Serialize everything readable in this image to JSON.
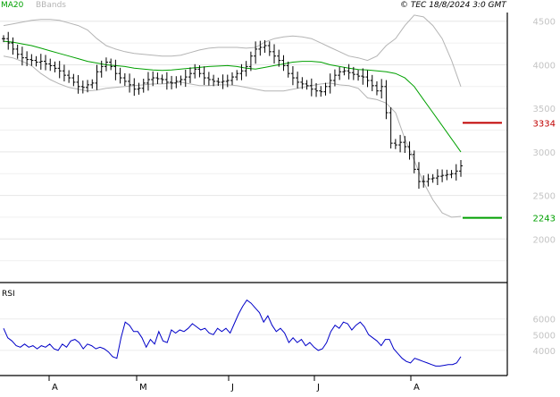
{
  "header": {
    "legend": [
      {
        "label": "MA20",
        "color": "#00a000"
      },
      {
        "label": "BBands",
        "color": "#b4b4b4"
      }
    ],
    "copyright": "© TEC 18/8/2024 3:0 GMT"
  },
  "chart_data": [
    {
      "type": "ohlc",
      "panel": "price",
      "y_ticks": [
        "4500",
        "4000",
        "3500",
        "3000",
        "2500",
        "2000"
      ],
      "ylim": [
        1500,
        4600
      ],
      "x_labels": [
        "A",
        "M",
        "J",
        "J",
        "A"
      ],
      "grid": true,
      "series": [
        {
          "name": "MA20",
          "color": "#00a000",
          "values": [
            4270,
            4260,
            4240,
            4220,
            4190,
            4160,
            4130,
            4100,
            4070,
            4040,
            4020,
            4000,
            3990,
            3980,
            3960,
            3950,
            3940,
            3935,
            3940,
            3950,
            3960,
            3970,
            3980,
            3985,
            3990,
            3980,
            3960,
            3950,
            3970,
            3990,
            4010,
            4030,
            4040,
            4040,
            4030,
            4000,
            3980,
            3960,
            3945,
            3940,
            3930,
            3920,
            3900,
            3850,
            3750,
            3600,
            3450,
            3300,
            3150,
            3000
          ]
        },
        {
          "name": "BBands",
          "color": "#b4b4b4",
          "upper": [
            4450,
            4470,
            4490,
            4510,
            4520,
            4520,
            4510,
            4480,
            4450,
            4400,
            4300,
            4220,
            4180,
            4150,
            4130,
            4120,
            4110,
            4100,
            4100,
            4110,
            4140,
            4170,
            4190,
            4200,
            4200,
            4200,
            4190,
            4200,
            4260,
            4300,
            4320,
            4330,
            4320,
            4300,
            4250,
            4200,
            4150,
            4100,
            4080,
            4050,
            4100,
            4220,
            4300,
            4450,
            4570,
            4550,
            4450,
            4300,
            4050,
            3750
          ],
          "lower": [
            4100,
            4080,
            4040,
            3990,
            3900,
            3830,
            3780,
            3740,
            3720,
            3700,
            3710,
            3730,
            3740,
            3750,
            3760,
            3770,
            3780,
            3780,
            3790,
            3800,
            3780,
            3760,
            3760,
            3770,
            3770,
            3760,
            3740,
            3720,
            3700,
            3700,
            3700,
            3720,
            3740,
            3760,
            3780,
            3790,
            3770,
            3760,
            3730,
            3620,
            3600,
            3560,
            3450,
            3150,
            2900,
            2650,
            2450,
            2300,
            2250,
            2260
          ]
        }
      ],
      "ohlc_approx_close": [
        4300,
        4250,
        4180,
        4120,
        4080,
        4060,
        4050,
        4030,
        4040,
        4010,
        3990,
        3960,
        3930,
        3880,
        3850,
        3800,
        3750,
        3740,
        3770,
        3790,
        3920,
        3980,
        4030,
        3980,
        3900,
        3850,
        3810,
        3770,
        3720,
        3730,
        3790,
        3830,
        3850,
        3840,
        3830,
        3800,
        3790,
        3810,
        3830,
        3860,
        3900,
        3950,
        3900,
        3850,
        3830,
        3810,
        3800,
        3810,
        3820,
        3860,
        3900,
        3930,
        3980,
        4100,
        4180,
        4200,
        4220,
        4150,
        4100,
        4050,
        3990,
        3900,
        3850,
        3800,
        3780,
        3760,
        3720,
        3700,
        3690,
        3750,
        3820,
        3880,
        3920,
        3930,
        3910,
        3890,
        3870,
        3860,
        3820,
        3760,
        3700,
        3750,
        3450,
        3100,
        3080,
        3110,
        3060,
        2970,
        2800,
        2660,
        2660,
        2690,
        2700,
        2720,
        2730,
        2740,
        2750,
        2780,
        2840
      ],
      "levels": [
        {
          "label": "3334",
          "value": 3334,
          "color": "#c00000"
        },
        {
          "label": "2243",
          "value": 2243,
          "color": "#00a000"
        }
      ]
    },
    {
      "type": "line",
      "panel": "rsi",
      "title": "RSI",
      "y_ticks": [
        "6000",
        "5000",
        "4000"
      ],
      "ylim": [
        2400,
        8200
      ],
      "series": [
        {
          "name": "RSI",
          "color": "#0000c8",
          "values": [
            5400,
            4800,
            4600,
            4300,
            4200,
            4400,
            4200,
            4300,
            4100,
            4300,
            4200,
            4400,
            4100,
            4000,
            4400,
            4200,
            4600,
            4700,
            4500,
            4100,
            4400,
            4300,
            4100,
            4200,
            4100,
            3900,
            3600,
            3500,
            4800,
            5800,
            5600,
            5200,
            5200,
            4800,
            4200,
            4700,
            4400,
            5200,
            4600,
            4500,
            5300,
            5100,
            5300,
            5200,
            5400,
            5700,
            5500,
            5300,
            5400,
            5100,
            5000,
            5400,
            5200,
            5400,
            5100,
            5700,
            6300,
            6800,
            7200,
            7000,
            6700,
            6400,
            5800,
            6200,
            5600,
            5200,
            5400,
            5100,
            4500,
            4800,
            4500,
            4700,
            4300,
            4500,
            4200,
            4000,
            4100,
            4500,
            5200,
            5600,
            5400,
            5800,
            5700,
            5300,
            5600,
            5800,
            5500,
            5000,
            4800,
            4600,
            4300,
            4700,
            4700,
            4100,
            3800,
            3500,
            3300,
            3200,
            3500,
            3400,
            3300,
            3200,
            3100,
            3000,
            3000,
            3050,
            3100,
            3100,
            3200,
            3600
          ]
        }
      ]
    }
  ]
}
